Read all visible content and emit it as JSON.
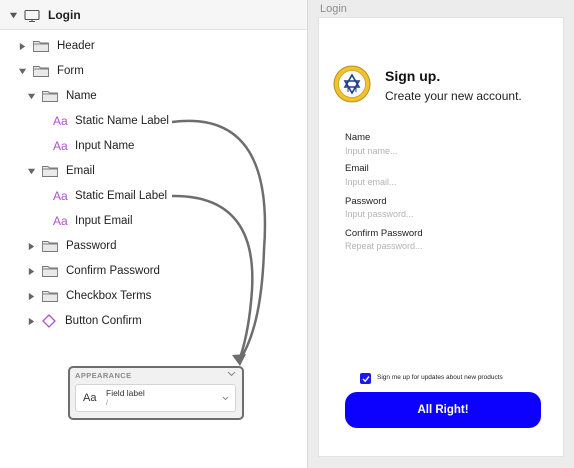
{
  "tree": {
    "root": {
      "label": "Login"
    },
    "rows": [
      {
        "key": "header",
        "label": "Header"
      },
      {
        "key": "form",
        "label": "Form"
      },
      {
        "key": "name",
        "label": "Name"
      },
      {
        "key": "static-name",
        "label": "Static Name Label"
      },
      {
        "key": "input-name",
        "label": "Input Name"
      },
      {
        "key": "email",
        "label": "Email"
      },
      {
        "key": "static-email",
        "label": "Static Email Label"
      },
      {
        "key": "input-email",
        "label": "Input Email"
      },
      {
        "key": "password",
        "label": "Password"
      },
      {
        "key": "confirm-password",
        "label": "Confirm Password"
      },
      {
        "key": "checkbox-terms",
        "label": "Checkbox Terms"
      },
      {
        "key": "button-confirm",
        "label": "Button Confirm"
      }
    ]
  },
  "icons": {
    "text_layer": "Aa",
    "folder": "folder-icon",
    "component": "diamond-icon",
    "device": "monitor-icon"
  },
  "appearance": {
    "title": "APPEARANCE",
    "field_icon": "Aa",
    "field_label": "Field label",
    "field_sub": "/"
  },
  "canvas": {
    "artboard_name": "Login",
    "title": "Sign up.",
    "subtitle": "Create your new account.",
    "fields": {
      "name": {
        "label": "Name",
        "placeholder": "Input name..."
      },
      "email": {
        "label": "Email",
        "placeholder": "Input email..."
      },
      "password": {
        "label": "Password",
        "placeholder": "Input password..."
      },
      "confirm": {
        "label": "Confirm Password",
        "placeholder": "Repeat password..."
      }
    },
    "terms": {
      "checked": true,
      "label": "Sign me up for updates about new products"
    },
    "button": {
      "label": "All Right!"
    }
  },
  "colors": {
    "accent": "#0c00ff",
    "text_layer": "#b44dd4",
    "component": "#b44dd4",
    "connector": "#6d6d6d"
  }
}
